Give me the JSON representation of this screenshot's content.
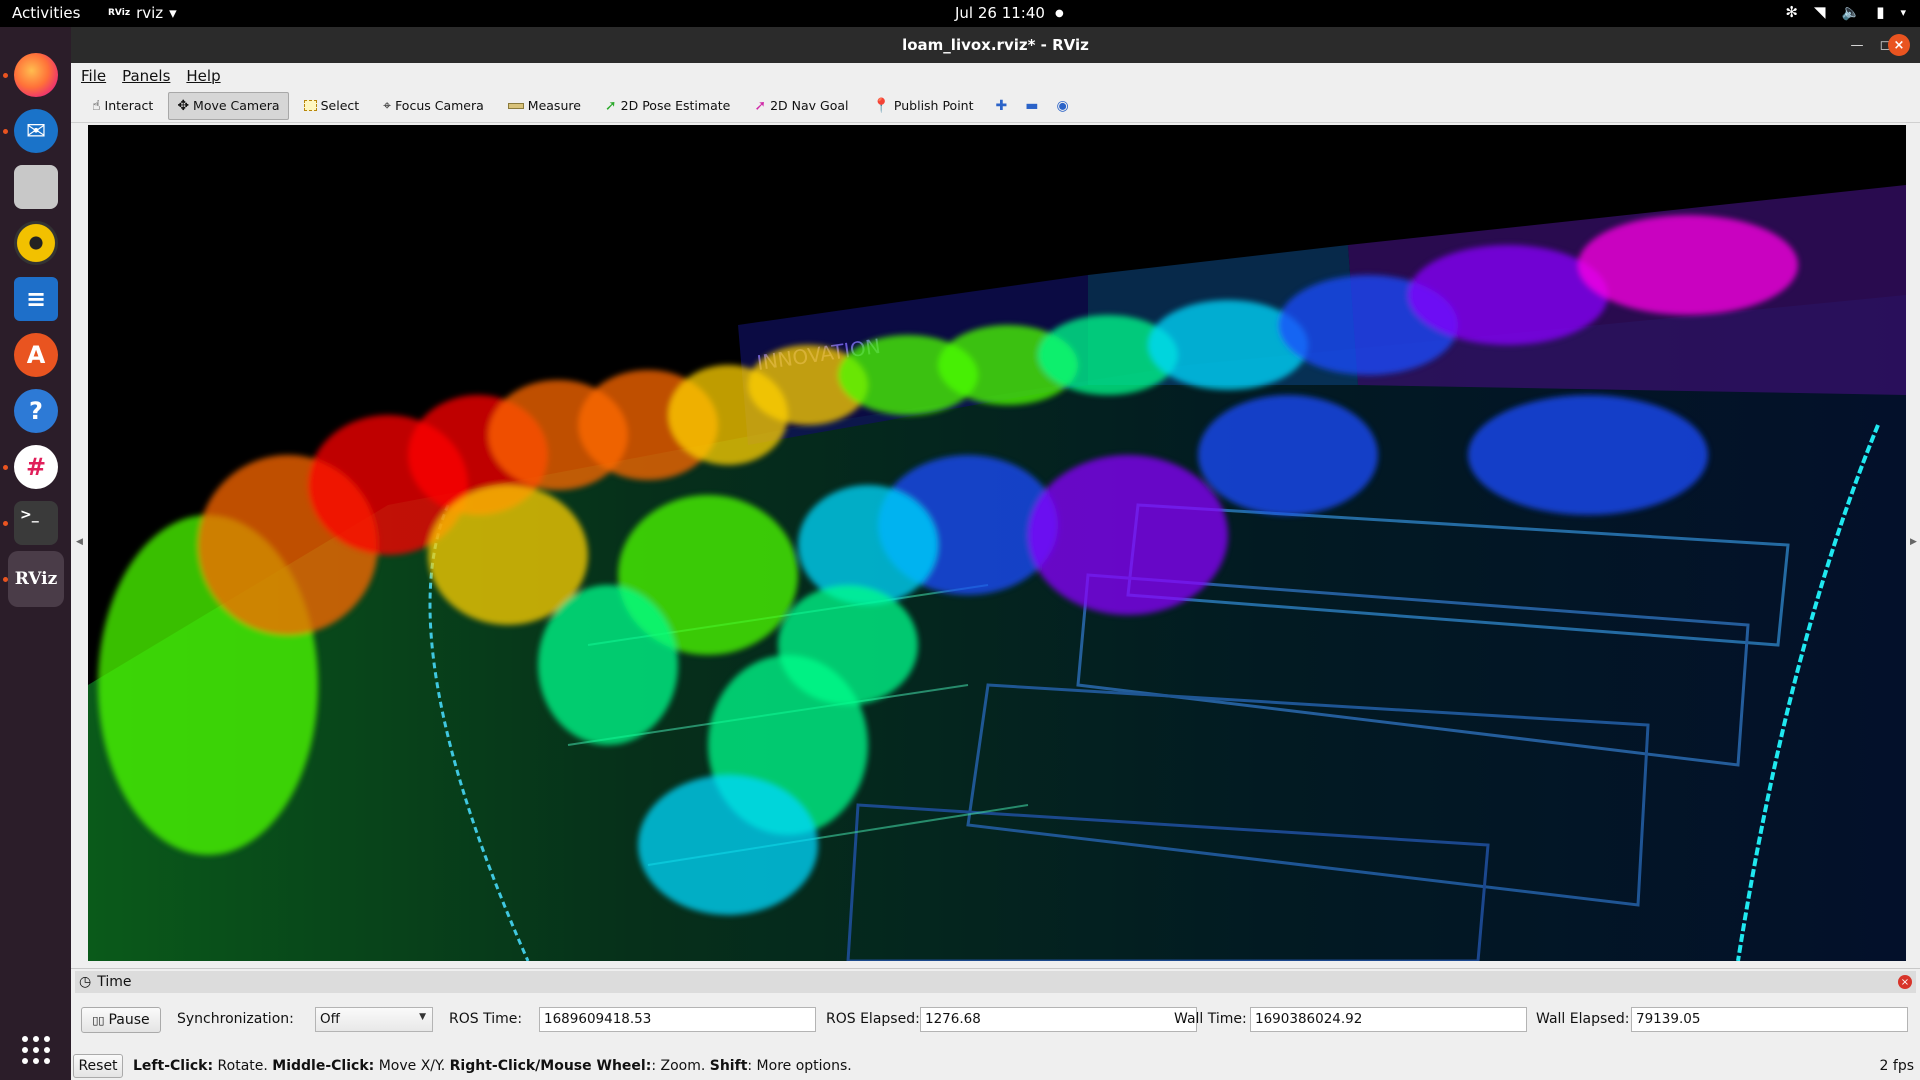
{
  "topbar": {
    "activities": "Activities",
    "app_icon_text": "RViz",
    "app_name": "rviz",
    "clock": "Jul 26  11:40"
  },
  "dock": {
    "items": [
      {
        "name": "firefox-icon",
        "glyph": "",
        "bg": "#e66000"
      },
      {
        "name": "thunderbird-icon",
        "glyph": "✉",
        "bg": "#1a73c9"
      },
      {
        "name": "files-icon",
        "glyph": "",
        "bg": "#c8c8c8"
      },
      {
        "name": "rhythmbox-icon",
        "glyph": "",
        "bg": "#f2c100"
      },
      {
        "name": "writer-icon",
        "glyph": "≡",
        "bg": "#1e6fc9"
      },
      {
        "name": "software-icon",
        "glyph": "A",
        "bg": "#e95420"
      },
      {
        "name": "help-icon",
        "glyph": "?",
        "bg": "#2d7ad6"
      },
      {
        "name": "slack-icon",
        "glyph": "#",
        "bg": "#ffffff"
      },
      {
        "name": "terminal-icon",
        "glyph": ">_",
        "bg": "#3a3a3a"
      },
      {
        "name": "rviz-icon",
        "glyph": "RViz",
        "bg": "transparent"
      }
    ],
    "apps_grid": "⠿"
  },
  "window": {
    "title": "loam_livox.rviz* - RViz"
  },
  "menu": {
    "file": "File",
    "panels": "Panels",
    "help": "Help"
  },
  "toolbar": {
    "interact": "Interact",
    "move_camera": "Move Camera",
    "select": "Select",
    "focus_camera": "Focus Camera",
    "measure": "Measure",
    "pose_estimate": "2D Pose Estimate",
    "nav_goal": "2D Nav Goal",
    "publish_point": "Publish Point",
    "active_tool": "Move Camera"
  },
  "time_panel": {
    "title": "Time",
    "pause_label": "Pause",
    "sync_label": "Synchronization:",
    "sync_value": "Off",
    "ros_time_label": "ROS Time:",
    "ros_time_value": "1689609418.53",
    "ros_elapsed_label": "ROS Elapsed:",
    "ros_elapsed_value": "1276.68",
    "wall_time_label": "Wall Time:",
    "wall_time_value": "1690386024.92",
    "wall_elapsed_label": "Wall Elapsed:",
    "wall_elapsed_value": "79139.05"
  },
  "statusbar": {
    "reset": "Reset",
    "help_left_click": "Left-Click:",
    "help_rotate": " Rotate. ",
    "help_middle_click": "Middle-Click:",
    "help_move": " Move X/Y. ",
    "help_right_click": "Right-Click/Mouse Wheel:",
    "help_zoom": ": Zoom. ",
    "help_shift": "Shift",
    "help_more": ": More options.",
    "fps": "2 fps"
  },
  "scene": {
    "sign_text": "INNOVATION",
    "colors": [
      "#ff0000",
      "#ff6a00",
      "#ffd000",
      "#4cff00",
      "#00ff8c",
      "#00d9ff",
      "#1a4dff",
      "#8a00ff",
      "#ff00e6"
    ]
  }
}
